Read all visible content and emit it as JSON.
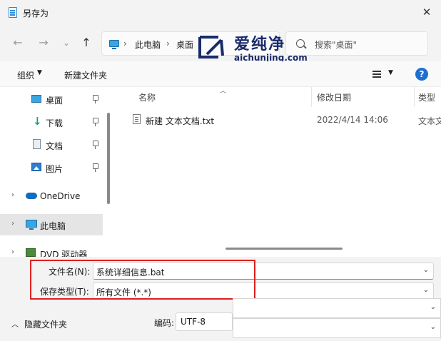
{
  "window": {
    "title": "另存为",
    "close_glyph": "✕"
  },
  "nav": {
    "back": "←",
    "forward": "→",
    "recent": "⌄",
    "up": "↑"
  },
  "address": {
    "crumbs": [
      "此电脑",
      "桌面"
    ],
    "separator": "›"
  },
  "search": {
    "placeholder": "搜索\"桌面\""
  },
  "watermark": {
    "title": "爱纯净",
    "url": "aichunjing.com"
  },
  "toolbar": {
    "organize": "组织",
    "new_folder": "新建文件夹",
    "help": "?"
  },
  "sidebar": {
    "items": [
      {
        "label": "桌面",
        "icon": "desktop-icon",
        "pinned": true
      },
      {
        "label": "下载",
        "icon": "download-icon",
        "pinned": true
      },
      {
        "label": "文档",
        "icon": "documents-icon",
        "pinned": true
      },
      {
        "label": "图片",
        "icon": "pictures-icon",
        "pinned": true
      },
      {
        "label": "OneDrive",
        "icon": "cloud-icon",
        "expandable": true
      },
      {
        "label": "此电脑",
        "icon": "pc-icon",
        "expandable": true,
        "selected": true
      },
      {
        "label": "DVD 驱动器 (D:)",
        "icon": "dvd-icon",
        "expandable": true
      }
    ]
  },
  "columns": {
    "name": "名称",
    "date": "修改日期",
    "type": "类型"
  },
  "files": [
    {
      "name": "新建 文本文档.txt",
      "date": "2022/4/14 14:06",
      "type": "文本文档"
    }
  ],
  "form": {
    "filename_label": "文件名(N):",
    "filename_value": "系统详细信息.bat",
    "filetype_label": "保存类型(T):",
    "filetype_value": "所有文件  (*.*)",
    "hide_folders": "隐藏文件夹",
    "encoding_label": "编码:",
    "encoding_value": "UTF-8"
  },
  "colors": {
    "highlight_border": "#e01f1f",
    "accent": "#1d6fd0"
  }
}
